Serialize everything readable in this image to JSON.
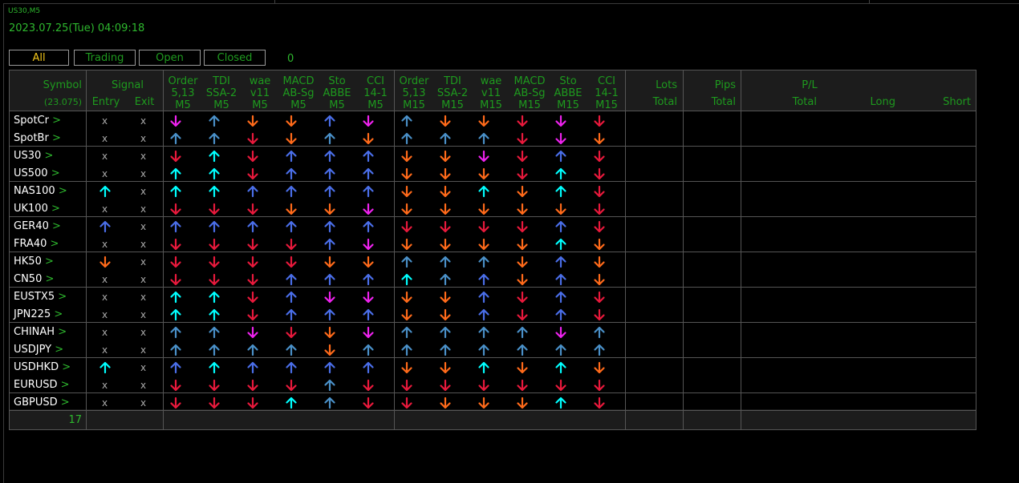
{
  "window": {
    "symbol_label": "US30,M5",
    "datetime": "2023.07.25(Tue) 04:09:18"
  },
  "tabs": [
    {
      "label": "All",
      "active": true
    },
    {
      "label": "Trading",
      "active": false
    },
    {
      "label": "Open",
      "active": false
    },
    {
      "label": "Closed",
      "active": false
    }
  ],
  "filter_count": "0",
  "header": {
    "symbol": "Symbol",
    "symbol_value": "(23.075)",
    "signal": "Signal",
    "entry": "Entry",
    "exit": "Exit",
    "indicators_m5": [
      [
        "Order",
        "5,13",
        "M5"
      ],
      [
        "TDI",
        "SSA-2",
        "M5"
      ],
      [
        "wae",
        "v11",
        "M5"
      ],
      [
        "MACD",
        "AB-Sg",
        "M5"
      ],
      [
        "Sto",
        "ABBE",
        "M5"
      ],
      [
        "CCI",
        "14-1",
        "M5"
      ]
    ],
    "indicators_m15": [
      [
        "Order",
        "5,13",
        "M15"
      ],
      [
        "TDI",
        "SSA-2",
        "M15"
      ],
      [
        "wae",
        "v11",
        "M15"
      ],
      [
        "MACD",
        "AB-Sg",
        "M15"
      ],
      [
        "Sto",
        "ABBE",
        "M15"
      ],
      [
        "CCI",
        "14-1",
        "M15"
      ]
    ],
    "lots": "Lots",
    "lots_total": "Total",
    "pips": "Pips",
    "pips_total": "Total",
    "pl": "P/L",
    "pl_total": "Total",
    "long": "Long",
    "short": "Short"
  },
  "arrow_colors": {
    "M": "#ee22ee",
    "C": "#4a90c8",
    "R": "#e8193c",
    "O": "#ff6a1a",
    "B": "#4a6ee8",
    "A": "#00ffff"
  },
  "rows": [
    {
      "symbol": "SpotCr",
      "entry": "",
      "exit": "x",
      "cells": "MCOOBM COORMR"
    },
    {
      "symbol": "SpotBr",
      "entry": "",
      "exit": "x",
      "cells": "CCROCO CCCRMO"
    },
    {
      "symbol": "US30",
      "entry": "",
      "exit": "x",
      "cells": "RARBBB OOMRBR"
    },
    {
      "symbol": "US500",
      "entry": "",
      "exit": "x",
      "cells": "AARBBB OOORAR"
    },
    {
      "symbol": "NAS100",
      "entry": "A",
      "exit": "x",
      "cells": "AABBBB OOAOAR"
    },
    {
      "symbol": "UK100",
      "entry": "",
      "exit": "x",
      "cells": "RRROOM OOOOOR"
    },
    {
      "symbol": "GER40",
      "entry": "B",
      "exit": "x",
      "cells": "BBBBBB RRRRBR"
    },
    {
      "symbol": "FRA40",
      "entry": "",
      "exit": "x",
      "cells": "RRRRBM OOOOAO"
    },
    {
      "symbol": "HK50",
      "entry": "O",
      "exit": "x",
      "cells": "RRRROO CCCOBO"
    },
    {
      "symbol": "CN50",
      "entry": "",
      "exit": "x",
      "cells": "RRRBBB ACBOBO"
    },
    {
      "symbol": "EUSTX5",
      "entry": "",
      "exit": "x",
      "cells": "AARBMM OOBRBR"
    },
    {
      "symbol": "JPN225",
      "entry": "",
      "exit": "x",
      "cells": "AARBBB OOBRBR"
    },
    {
      "symbol": "CHINAH",
      "entry": "",
      "exit": "x",
      "cells": "CCMROM CCCCMC"
    },
    {
      "symbol": "USDJPY",
      "entry": "",
      "exit": "x",
      "cells": "CCCCOC CCCCCC"
    },
    {
      "symbol": "USDHKD",
      "entry": "A",
      "exit": "x",
      "cells": "BABBBB OOAOAO"
    },
    {
      "symbol": "EURUSD",
      "entry": "",
      "exit": "x",
      "cells": "RRRRCR RRRRRR"
    },
    {
      "symbol": "GBPUSD",
      "entry": "",
      "exit": "x",
      "cells": "RRRACR ROOOAR"
    }
  ],
  "entry_placeholder": "x",
  "row_count": "17"
}
